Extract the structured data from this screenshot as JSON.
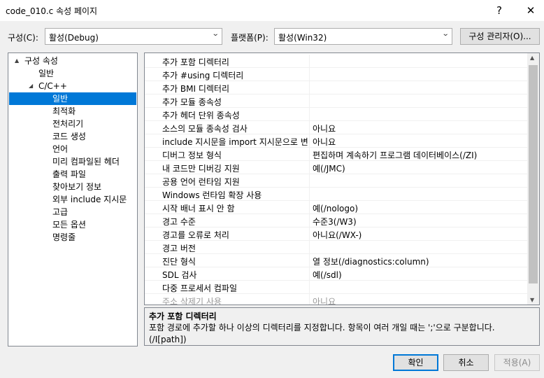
{
  "window": {
    "title": "code_010.c 속성 페이지",
    "help_label": "?",
    "close_label": "✕"
  },
  "header": {
    "config_label": "구성(C):",
    "config_value": "활성(Debug)",
    "platform_label": "플랫폼(P):",
    "platform_value": "활성(Win32)",
    "config_manager_label": "구성 관리자(O)..."
  },
  "tree": {
    "items": [
      {
        "label": "구성 속성",
        "expander": "▲"
      },
      {
        "label": "일반"
      },
      {
        "label": "C/C++",
        "expander": "◢"
      },
      {
        "label": "일반",
        "selected": true
      },
      {
        "label": "최적화"
      },
      {
        "label": "전처리기"
      },
      {
        "label": "코드 생성"
      },
      {
        "label": "언어"
      },
      {
        "label": "미리 컴파일된 헤더"
      },
      {
        "label": "출력 파일"
      },
      {
        "label": "찾아보기 정보"
      },
      {
        "label": "외부 include 지시문"
      },
      {
        "label": "고급"
      },
      {
        "label": "모든 옵션"
      },
      {
        "label": "명령줄"
      }
    ]
  },
  "properties": [
    {
      "name": "추가 포함 디렉터리",
      "value": ""
    },
    {
      "name": "추가 #using 디렉터리",
      "value": ""
    },
    {
      "name": "추가 BMI 디렉터리",
      "value": ""
    },
    {
      "name": "추가 모듈 종속성",
      "value": ""
    },
    {
      "name": "추가 헤더 단위 종속성",
      "value": ""
    },
    {
      "name": "소스의 모듈 종속성 검사",
      "value": "아니요"
    },
    {
      "name": "include 지시문을 import 지시문으로 변",
      "value": "아니요"
    },
    {
      "name": "디버그 정보 형식",
      "value": "편집하며 계속하기 프로그램 데이터베이스(/ZI)"
    },
    {
      "name": "내 코드만 디버깅 지원",
      "value": "예(/JMC)"
    },
    {
      "name": "공용 언어 런타임 지원",
      "value": ""
    },
    {
      "name": "Windows 런타임 확장 사용",
      "value": ""
    },
    {
      "name": "시작 배너 표시 안 함",
      "value": "예(/nologo)"
    },
    {
      "name": "경고 수준",
      "value": "수준3(/W3)"
    },
    {
      "name": "경고를 오류로 처리",
      "value": "아니요(/WX-)"
    },
    {
      "name": "경고 버전",
      "value": ""
    },
    {
      "name": "진단 형식",
      "value": "열 정보(/diagnostics:column)"
    },
    {
      "name": "SDL 검사",
      "value": "예(/sdl)"
    },
    {
      "name": "다중 프로세서 컴파일",
      "value": ""
    },
    {
      "name": "주소 삭제기 사용",
      "value": "아니요",
      "dim": true
    }
  ],
  "description": {
    "title": "추가 포함 디렉터리",
    "text": "포함 경로에 추가할 하나 이상의 디렉터리를 지정합니다. 항목이 여러 개일 때는 ';'으로 구분합니다. (/I[path])"
  },
  "footer": {
    "ok_label": "확인",
    "cancel_label": "취소",
    "apply_label": "적용(A)"
  }
}
